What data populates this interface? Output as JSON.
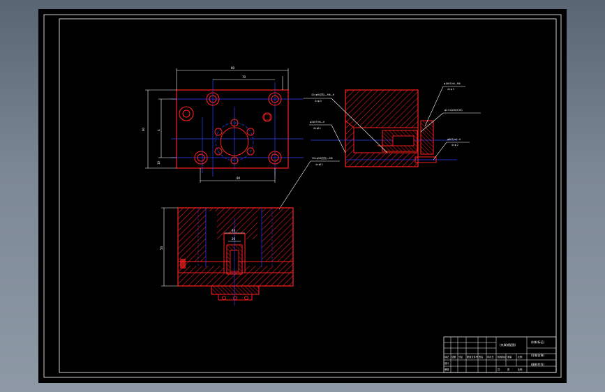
{
  "drawing": {
    "dimensions": {
      "top_view_width": "80",
      "top_view_hole_spacing": "70",
      "top_view_bottom_span": "80",
      "top_view_height": "60",
      "top_view_inner_height": "4",
      "top_view_small": "10",
      "front_view_height": "50",
      "front_view_bore_top": "40",
      "front_view_bore_inner": "20"
    },
    "leaders": {
      "left_upper_1": "32×φ9(沉孔)—M6—H",
      "left_upper_2": "4×φ 5",
      "left_mid_1": "φ24H7/h6—H",
      "left_mid_2": "4×φ11",
      "left_lower_1": "32×φ18(沉孔)—M6",
      "left_lower_2": "4×φ11",
      "right_upper_1": "φ16H7/n6—M6",
      "right_upper_2": "4×φ 5",
      "right_mid": "φ2.5×φ30(5/16)",
      "right_lower_1": "φ8H7/n6—H",
      "right_lower_2": "4×φ 2"
    },
    "title_block": {
      "drawing_name": "(夹具装配图)",
      "company": "(学校名称)",
      "drawing_no": "(图样代号)",
      "material": "(材料标记)",
      "scale_label": "比例",
      "sheet_label": "张",
      "count_label": "共",
      "weight_label": "重量",
      "row_labels": [
        "标记",
        "设计",
        "审核",
        "工艺"
      ],
      "col_labels": [
        "处数",
        "分区",
        "更改文件号",
        "签名",
        "年月日"
      ],
      "stage_labels": [
        "阶段标记",
        "重量",
        "比例"
      ]
    }
  }
}
